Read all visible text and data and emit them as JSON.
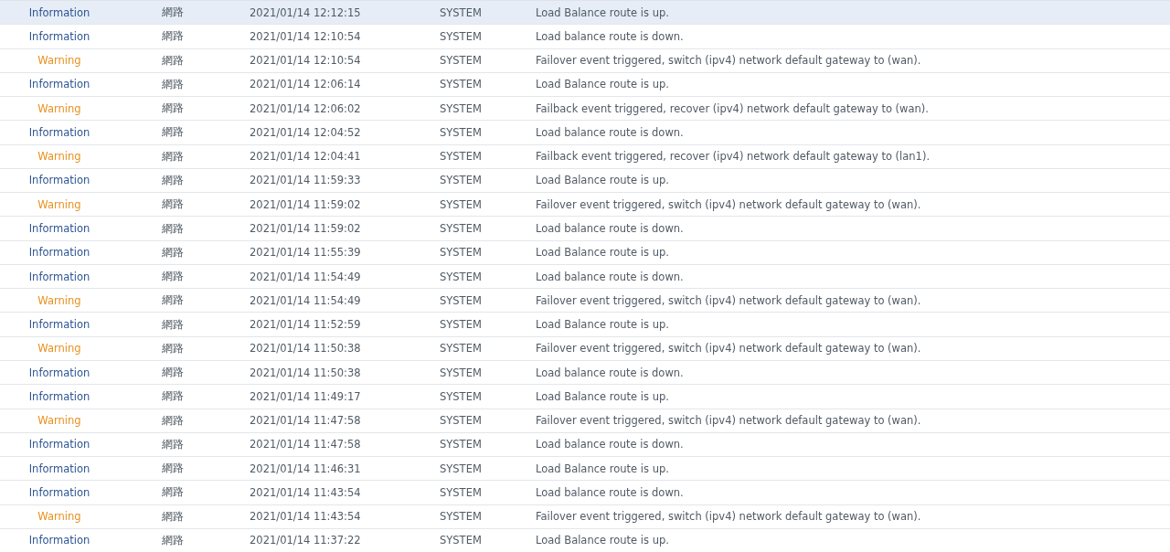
{
  "log": {
    "rows": [
      {
        "level": "Information",
        "kind": "info",
        "selected": true,
        "category": "網路",
        "time": "2021/01/14 12:12:15",
        "user": "SYSTEM",
        "event": "Load Balance route is up."
      },
      {
        "level": "Information",
        "kind": "info",
        "selected": false,
        "category": "網路",
        "time": "2021/01/14 12:10:54",
        "user": "SYSTEM",
        "event": "Load balance route is down."
      },
      {
        "level": "Warning",
        "kind": "warning",
        "selected": false,
        "category": "網路",
        "time": "2021/01/14 12:10:54",
        "user": "SYSTEM",
        "event": "Failover event triggered, switch (ipv4) network default gateway to (wan)."
      },
      {
        "level": "Information",
        "kind": "info",
        "selected": false,
        "category": "網路",
        "time": "2021/01/14 12:06:14",
        "user": "SYSTEM",
        "event": "Load Balance route is up."
      },
      {
        "level": "Warning",
        "kind": "warning",
        "selected": false,
        "category": "網路",
        "time": "2021/01/14 12:06:02",
        "user": "SYSTEM",
        "event": "Failback event triggered, recover (ipv4) network default gateway to (wan)."
      },
      {
        "level": "Information",
        "kind": "info",
        "selected": false,
        "category": "網路",
        "time": "2021/01/14 12:04:52",
        "user": "SYSTEM",
        "event": "Load balance route is down."
      },
      {
        "level": "Warning",
        "kind": "warning",
        "selected": false,
        "category": "網路",
        "time": "2021/01/14 12:04:41",
        "user": "SYSTEM",
        "event": "Failback event triggered, recover (ipv4) network default gateway to (lan1)."
      },
      {
        "level": "Information",
        "kind": "info",
        "selected": false,
        "category": "網路",
        "time": "2021/01/14 11:59:33",
        "user": "SYSTEM",
        "event": "Load Balance route is up."
      },
      {
        "level": "Warning",
        "kind": "warning",
        "selected": false,
        "category": "網路",
        "time": "2021/01/14 11:59:02",
        "user": "SYSTEM",
        "event": "Failover event triggered, switch (ipv4) network default gateway to (wan)."
      },
      {
        "level": "Information",
        "kind": "info",
        "selected": false,
        "category": "網路",
        "time": "2021/01/14 11:59:02",
        "user": "SYSTEM",
        "event": "Load balance route is down."
      },
      {
        "level": "Information",
        "kind": "info",
        "selected": false,
        "category": "網路",
        "time": "2021/01/14 11:55:39",
        "user": "SYSTEM",
        "event": "Load Balance route is up."
      },
      {
        "level": "Information",
        "kind": "info",
        "selected": false,
        "category": "網路",
        "time": "2021/01/14 11:54:49",
        "user": "SYSTEM",
        "event": "Load balance route is down."
      },
      {
        "level": "Warning",
        "kind": "warning",
        "selected": false,
        "category": "網路",
        "time": "2021/01/14 11:54:49",
        "user": "SYSTEM",
        "event": "Failover event triggered, switch (ipv4) network default gateway to (wan)."
      },
      {
        "level": "Information",
        "kind": "info",
        "selected": false,
        "category": "網路",
        "time": "2021/01/14 11:52:59",
        "user": "SYSTEM",
        "event": "Load Balance route is up."
      },
      {
        "level": "Warning",
        "kind": "warning",
        "selected": false,
        "category": "網路",
        "time": "2021/01/14 11:50:38",
        "user": "SYSTEM",
        "event": "Failover event triggered, switch (ipv4) network default gateway to (wan)."
      },
      {
        "level": "Information",
        "kind": "info",
        "selected": false,
        "category": "網路",
        "time": "2021/01/14 11:50:38",
        "user": "SYSTEM",
        "event": "Load balance route is down."
      },
      {
        "level": "Information",
        "kind": "info",
        "selected": false,
        "category": "網路",
        "time": "2021/01/14 11:49:17",
        "user": "SYSTEM",
        "event": "Load Balance route is up."
      },
      {
        "level": "Warning",
        "kind": "warning",
        "selected": false,
        "category": "網路",
        "time": "2021/01/14 11:47:58",
        "user": "SYSTEM",
        "event": "Failover event triggered, switch (ipv4) network default gateway to (wan)."
      },
      {
        "level": "Information",
        "kind": "info",
        "selected": false,
        "category": "網路",
        "time": "2021/01/14 11:47:58",
        "user": "SYSTEM",
        "event": "Load balance route is down."
      },
      {
        "level": "Information",
        "kind": "info",
        "selected": false,
        "category": "網路",
        "time": "2021/01/14 11:46:31",
        "user": "SYSTEM",
        "event": "Load Balance route is up."
      },
      {
        "level": "Information",
        "kind": "info",
        "selected": false,
        "category": "網路",
        "time": "2021/01/14 11:43:54",
        "user": "SYSTEM",
        "event": "Load balance route is down."
      },
      {
        "level": "Warning",
        "kind": "warning",
        "selected": false,
        "category": "網路",
        "time": "2021/01/14 11:43:54",
        "user": "SYSTEM",
        "event": "Failover event triggered, switch (ipv4) network default gateway to (wan)."
      },
      {
        "level": "Information",
        "kind": "info",
        "selected": false,
        "category": "網路",
        "time": "2021/01/14 11:37:22",
        "user": "SYSTEM",
        "event": "Load Balance route is up."
      }
    ]
  }
}
